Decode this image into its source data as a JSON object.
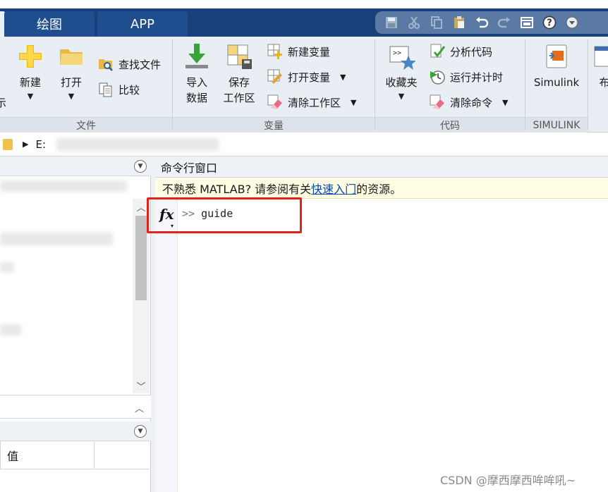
{
  "tabs": [
    {
      "label": "绘图"
    },
    {
      "label": "APP"
    }
  ],
  "ribbon": {
    "file_group": {
      "title": "文件",
      "partial_left": "示",
      "new": "新建",
      "open": "打开",
      "find_files": "查找文件",
      "compare": "比较"
    },
    "variable_group": {
      "title": "变量",
      "import": "导入\n数据",
      "import_line1": "导入",
      "import_line2": "数据",
      "save_line1": "保存",
      "save_line2": "工作区",
      "new_variable": "新建变量",
      "open_variable": "打开变量",
      "clear_workspace": "清除工作区"
    },
    "code_group": {
      "title": "代码",
      "favorites": "收藏夹",
      "analyze_code": "分析代码",
      "run_and_time": "运行并计时",
      "clear_commands": "清除命令"
    },
    "simulink_group": {
      "title": "SIMULINK",
      "simulink": "Simulink",
      "partial_right": "布"
    }
  },
  "address": {
    "path": "E:"
  },
  "left_panel": {
    "workspace_value_col": "值"
  },
  "command_window": {
    "title": "命令行窗口",
    "notice_prefix": "不熟悉 MATLAB? 请参阅有关",
    "notice_link": "快速入门",
    "notice_suffix": "的资源。",
    "fx_label": "fx",
    "prompt_symbol": ">>",
    "command_text": "guide"
  },
  "watermark": "CSDN @摩西摩西哞哞吼~",
  "colors": {
    "title_bar": "#19407a",
    "ribbon_bg": "#e9eef4",
    "notice_bg": "#fffde3",
    "link": "#0645ad",
    "highlight_box": "#e2231a"
  }
}
